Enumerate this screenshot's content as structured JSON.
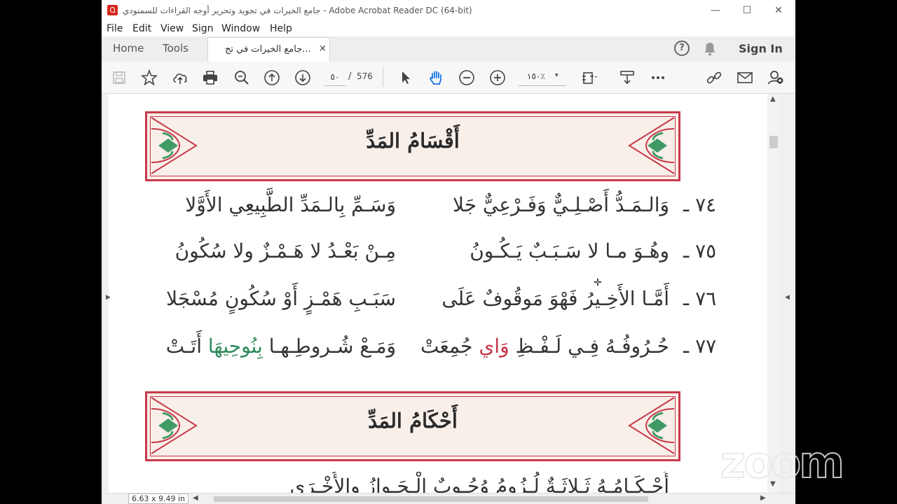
{
  "window": {
    "title": "جامع الخيرات في تجويد وتحرير أوجه القراءات للسمنودي - Adobe Acrobat Reader DC (64-bit)",
    "controls": {
      "minimize": "—",
      "maximize": "☐",
      "close": "✕"
    }
  },
  "menu": [
    "File",
    "Edit",
    "View",
    "Sign",
    "Window",
    "Help"
  ],
  "tabs": {
    "home": "Home",
    "tools": "Tools",
    "document": "جامع الخيرات في تج...",
    "close": "×"
  },
  "header_right": {
    "help": "?",
    "sign_in": "Sign In"
  },
  "toolbar": {
    "page_current": "٥٠",
    "page_separator": "/",
    "page_total": "576",
    "zoom": "١٥٠٪",
    "zoom_caret": "▾"
  },
  "document": {
    "section1_title": "أَقْسَامُ المَدِّ",
    "verses": [
      {
        "num": "٧٤ ـ",
        "right": "وَالـمَـدُّ أَصْـلِـيٌّ وَفَـرْعِيٌّ جَلا",
        "left": "وَسَـمِّ بِالـمَدِّ الطَّبِيعِي الأَوَّلا"
      },
      {
        "num": "٧٥ ـ",
        "right": "وهُـوَ مـا لا سَـبَـبٌ يَـكُـونُ",
        "left": "مِـنْ بَعْـدُ لا هَـمْـزٌ ولا سُكُونُ"
      },
      {
        "num": "٧٦ ـ",
        "right": "أَمَّـا الأَخِـيرُ فَهْوَ مَوقُوفٌ عَلَى",
        "left": "سَبَـبِ هَمْـزٍ أَوْ سُكُونٍ مُسْجَلا"
      },
      {
        "num": "٧٧ ـ",
        "right_before": "حُـرُوفُـهُ فِـي لَـفْـظِ",
        "right_highlight": "وَاي",
        "right_after": "جُمِعَتْ",
        "left_before": "وَمَـعْ شُـروطِـهـا",
        "left_highlight": "بِنُوحِيهَا",
        "left_after": "أَتَـتْ"
      }
    ],
    "section2_title": "أَحْكَامُ المَدِّ",
    "partial_verse": "أَحْـكَـامُـهُ ثَـلاثَـةٌ  لُـزُومُ          وُجُـوبٌ الْـجَـوازُ والأُخْـرَى"
  },
  "status": {
    "page_size": "6.63 x 9.49 in"
  },
  "overlay": {
    "zoom_logo": "zoom"
  },
  "colors": {
    "accent_red": "#c93a4a",
    "accent_green": "#2c8a5a",
    "banner_bg": "#f8efe9"
  }
}
